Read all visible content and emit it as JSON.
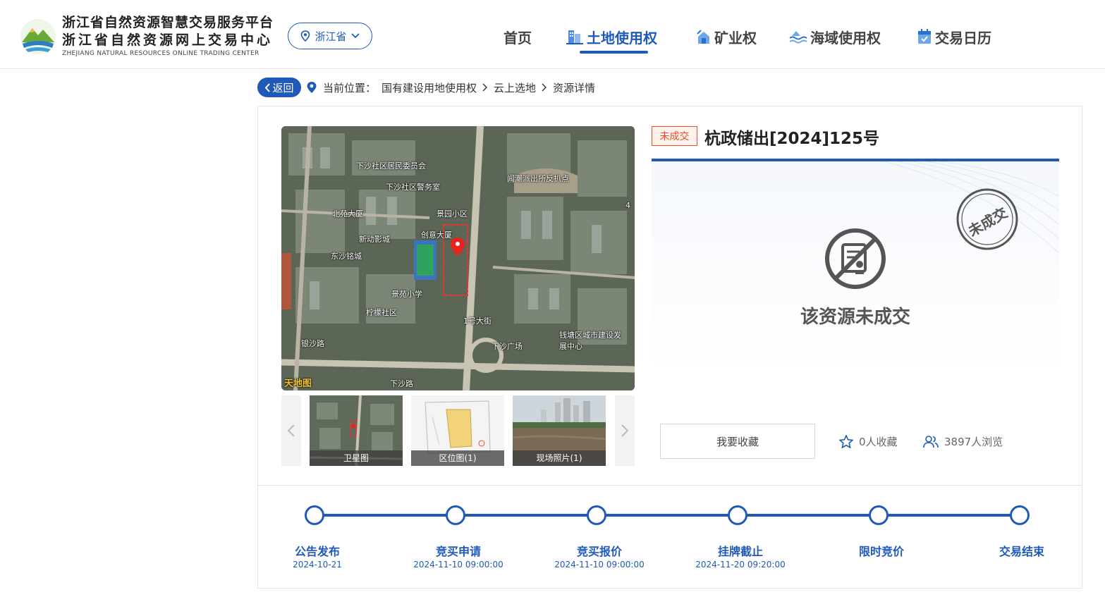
{
  "header": {
    "brand_line1": "浙江省自然资源智慧交易服务平台",
    "brand_line2": "浙江省自然资源网上交易中心",
    "brand_line3": "ZHEJIANG NATURAL RESOURCES ONLINE TRADING CENTER",
    "province": "浙江省",
    "nav": [
      {
        "label": "首页",
        "icon": "none",
        "active": false
      },
      {
        "label": "土地使用权",
        "icon": "building-icon",
        "active": true
      },
      {
        "label": "矿业权",
        "icon": "mine-icon",
        "active": false
      },
      {
        "label": "海域使用权",
        "icon": "wave-icon",
        "active": false
      },
      {
        "label": "交易日历",
        "icon": "calendar-icon",
        "active": false
      }
    ]
  },
  "breadcrumb": {
    "back_label": "返回",
    "prefix": "当前位置：",
    "items": [
      "国有建设用地使用权",
      "云上选地",
      "资源详情"
    ]
  },
  "map": {
    "watermark": "天地图",
    "labels": [
      "下沙社区居民委员会",
      "下沙社区警务室",
      "闻潮派出所反扒点",
      "北苑大厦",
      "景园小区",
      "创意大厦",
      "新动影城",
      "东沙铭城",
      "景苑小学",
      "柠檬社区",
      "1号大街",
      "下沙广场",
      "钱塘区城市建设发展中心",
      "下沙路",
      "银沙路",
      "4"
    ]
  },
  "thumbnails": [
    {
      "caption": "卫星图"
    },
    {
      "caption": "区位图(1)"
    },
    {
      "caption": "现场照片(1)"
    }
  ],
  "resource": {
    "status_tag": "未成交",
    "title": "杭政储出[2024]125号",
    "stamp_text": "未成交",
    "result_text": "该资源未成交",
    "favorite_button": "我要收藏",
    "favorites": "0人收藏",
    "views": "3897人浏览"
  },
  "timeline": [
    {
      "label": "公告发布",
      "date": "2024-10-21"
    },
    {
      "label": "竞买申请",
      "date": "2024-11-10 09:00:00"
    },
    {
      "label": "竞买报价",
      "date": "2024-11-10 09:00:00"
    },
    {
      "label": "挂牌截止",
      "date": "2024-11-20 09:20:00"
    },
    {
      "label": "限时竞价",
      "date": ""
    },
    {
      "label": "交易结束",
      "date": ""
    }
  ],
  "colors": {
    "accent": "#1f5ab8",
    "status_red": "#e84e2a"
  }
}
